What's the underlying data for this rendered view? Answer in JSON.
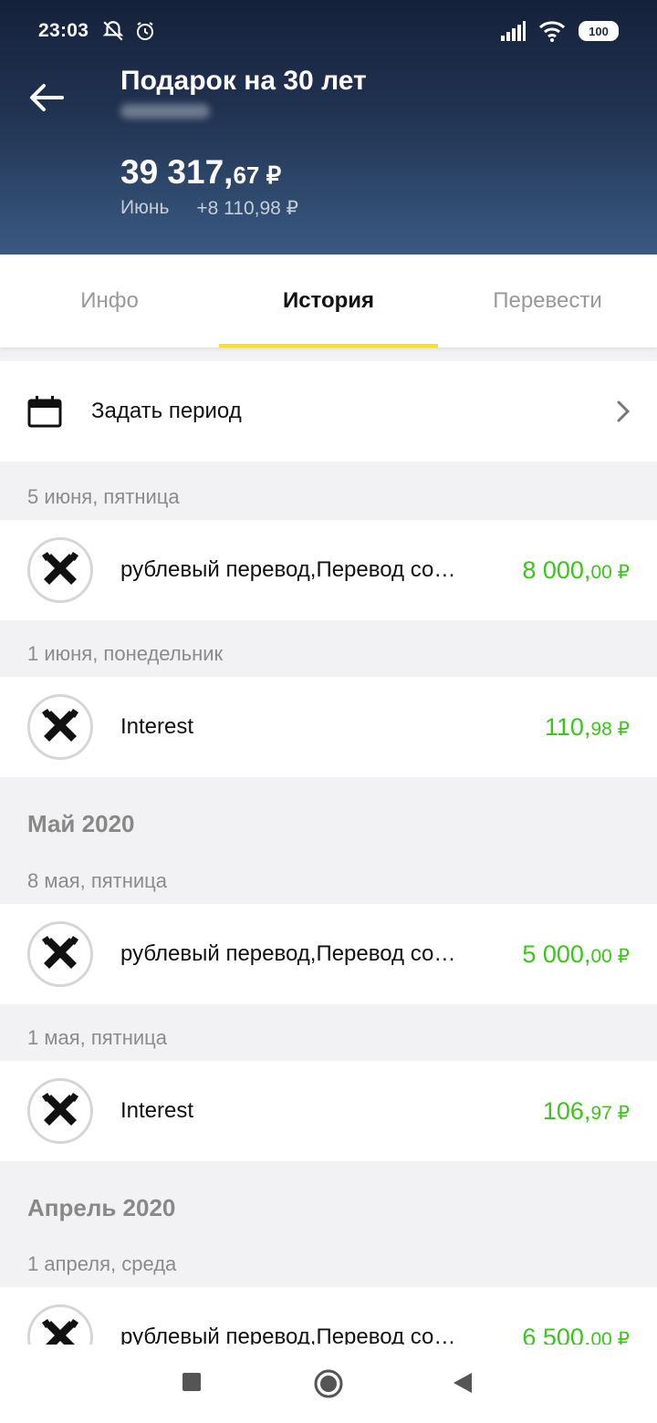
{
  "status": {
    "time": "23:03",
    "battery": "100"
  },
  "header": {
    "title": "Подарок на 30 лет",
    "balance_main": "39 317,",
    "balance_kop": "67 ₽",
    "month_label": "Июнь",
    "month_change": "+8 110,98 ₽"
  },
  "tabs": [
    {
      "label": "Инфо"
    },
    {
      "label": "История"
    },
    {
      "label": "Перевести"
    }
  ],
  "period": {
    "label": "Задать период"
  },
  "history": {
    "d1": "5 июня, пятница",
    "t1": {
      "name": "рублевый перевод,Перевод со…",
      "amount": "8 000,",
      "kop": "00 ₽"
    },
    "d2": "1 июня, понедельник",
    "t2": {
      "name": "Interest",
      "amount": "110,",
      "kop": "98 ₽"
    },
    "m1": "Май 2020",
    "d3": "8 мая, пятница",
    "t3": {
      "name": "рублевый перевод,Перевод со…",
      "amount": "5 000,",
      "kop": "00 ₽"
    },
    "d4": "1 мая, пятница",
    "t4": {
      "name": "Interest",
      "amount": "106,",
      "kop": "97 ₽"
    },
    "m2": "Апрель 2020",
    "d5": "1 апреля, среда",
    "t5": {
      "name": "рублевый перевод,Перевод со…",
      "amount": "6 500,",
      "kop": "00 ₽"
    }
  },
  "colors": {
    "accent": "#fedc2a",
    "income": "#3bc51d",
    "header_top": "#15213a",
    "header_bottom": "#3a5a82"
  },
  "icons": [
    "bell-off-icon",
    "alarm-icon",
    "signal-icon",
    "wifi-icon",
    "battery-icon",
    "back-arrow-icon",
    "calendar-icon",
    "chevron-right-icon",
    "bank-logo-icon",
    "nav-square-icon",
    "nav-circle-icon",
    "nav-back-icon"
  ]
}
